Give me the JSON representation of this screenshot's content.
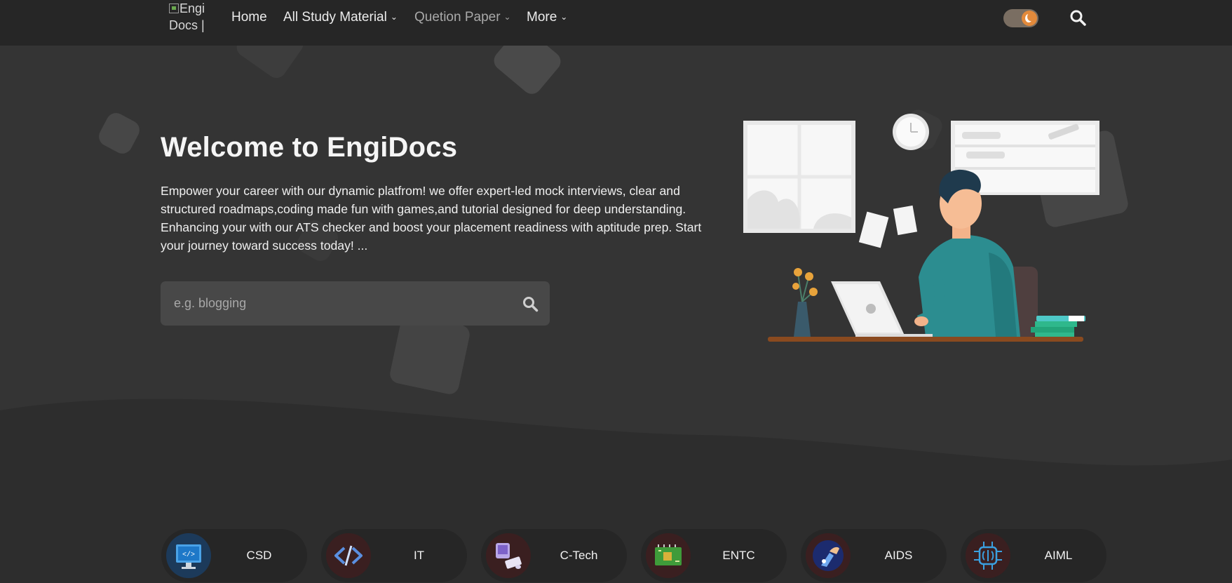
{
  "nav": {
    "logo_alt": "EngiDocs | Engi",
    "logo_text": "Engi Docs |",
    "items": [
      {
        "label": "Home",
        "has_dropdown": false
      },
      {
        "label": "All Study Material",
        "has_dropdown": true
      },
      {
        "label": "Quetion Paper",
        "has_dropdown": true
      },
      {
        "label": "More",
        "has_dropdown": true
      }
    ],
    "theme_toggle_icon": "moon-icon",
    "search_icon": "search-icon"
  },
  "hero": {
    "title": "Welcome to EngiDocs",
    "description": "Empower your career with our dynamic platfrom! we offer expert-led mock interviews, clear and structured roadmaps,coding made fun with games,and tutorial designed for deep understanding. Enhancing your with our ATS checker and boost your placement readiness with aptitude prep. Start your journey toward success today! ...",
    "search_placeholder": "e.g. blogging",
    "search_icon": "search-icon",
    "illustration": "person-working-on-laptop-illustration"
  },
  "branches": [
    {
      "label": "CSD",
      "icon": "computer-code-icon"
    },
    {
      "label": "IT",
      "icon": "code-brackets-icon"
    },
    {
      "label": "C-Tech",
      "icon": "desktop-computer-icon"
    },
    {
      "label": "ENTC",
      "icon": "circuit-chip-icon"
    },
    {
      "label": "AIDS",
      "icon": "robot-hand-icon"
    },
    {
      "label": "AIML",
      "icon": "ai-brain-chip-icon"
    }
  ],
  "colors": {
    "background": "#2c2c2c",
    "navbar": "#262626",
    "accent": "#e38a3b",
    "teal": "#2c8d90"
  }
}
